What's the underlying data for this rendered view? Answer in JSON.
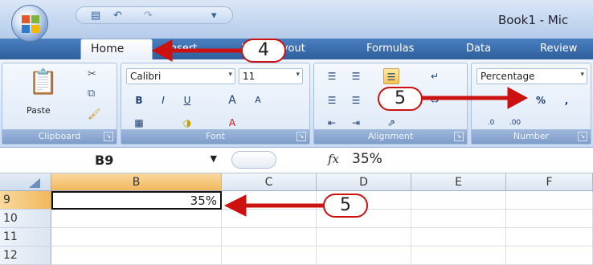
{
  "titlebar": {
    "app_title": "Book1 - Mic",
    "qat_icons": [
      "save-icon",
      "undo-icon",
      "redo-icon",
      "customize-icon"
    ]
  },
  "tabs": [
    {
      "label": "Home"
    },
    {
      "label": "Insert"
    },
    {
      "label": "Page Layout"
    },
    {
      "label": "Formulas"
    },
    {
      "label": "Data"
    },
    {
      "label": "Review"
    }
  ],
  "ribbon": {
    "clipboard": {
      "label": "Clipboard",
      "paste_label": "Paste"
    },
    "font": {
      "label": "Font",
      "font_name": "Calibri",
      "font_size": "11",
      "bold": "B",
      "italic": "I",
      "underline": "U",
      "grow": "A",
      "shrink": "A",
      "color": "A"
    },
    "alignment": {
      "label": "Alignment"
    },
    "number": {
      "label": "Number",
      "format": "Percentage",
      "percent_button": "%",
      "comma": ","
    }
  },
  "formula_bar": {
    "name_box": "B9",
    "fx": "fx",
    "value": "35%"
  },
  "grid": {
    "columns": [
      "B",
      "C",
      "D",
      "E",
      "F"
    ],
    "rows": [
      "9",
      "10",
      "11",
      "12"
    ],
    "active_cell_value": "35%"
  },
  "annotations": {
    "step4": "4",
    "step5_ribbon": "5",
    "step5_grid": "5"
  },
  "colors": {
    "annotation": "#cc1111",
    "tab_bar": "#2f5f9c",
    "active_header": "#f1b75b"
  }
}
